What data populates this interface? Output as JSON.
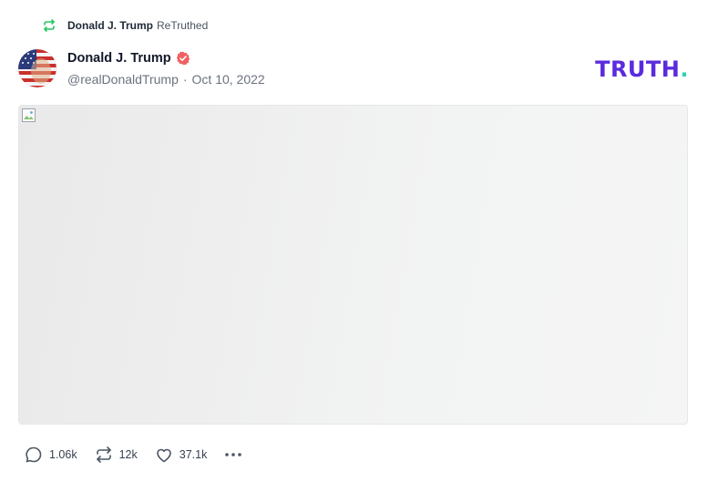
{
  "retruth": {
    "name": "Donald J. Trump",
    "action": "ReTruthed",
    "icon": "retruth-icon"
  },
  "post": {
    "author": {
      "display_name": "Donald J. Trump",
      "handle": "@realDonaldTrump",
      "verified": true
    },
    "separator": "·",
    "date": "Oct 10, 2022",
    "media": {
      "type": "image",
      "state": "broken-image"
    }
  },
  "brand": {
    "logo_text": "TRUTH",
    "logo_dot": ".",
    "primary_color": "#5b2bde",
    "accent_color": "#2ed3b7"
  },
  "actions": {
    "replies": "1.06k",
    "retruths": "12k",
    "likes": "37.1k",
    "icons": [
      "reply-icon",
      "retruth-icon",
      "like-icon",
      "more-icon"
    ]
  },
  "colors": {
    "retruth_icon": "#22c55e",
    "verified_badge": "#ef4444"
  }
}
